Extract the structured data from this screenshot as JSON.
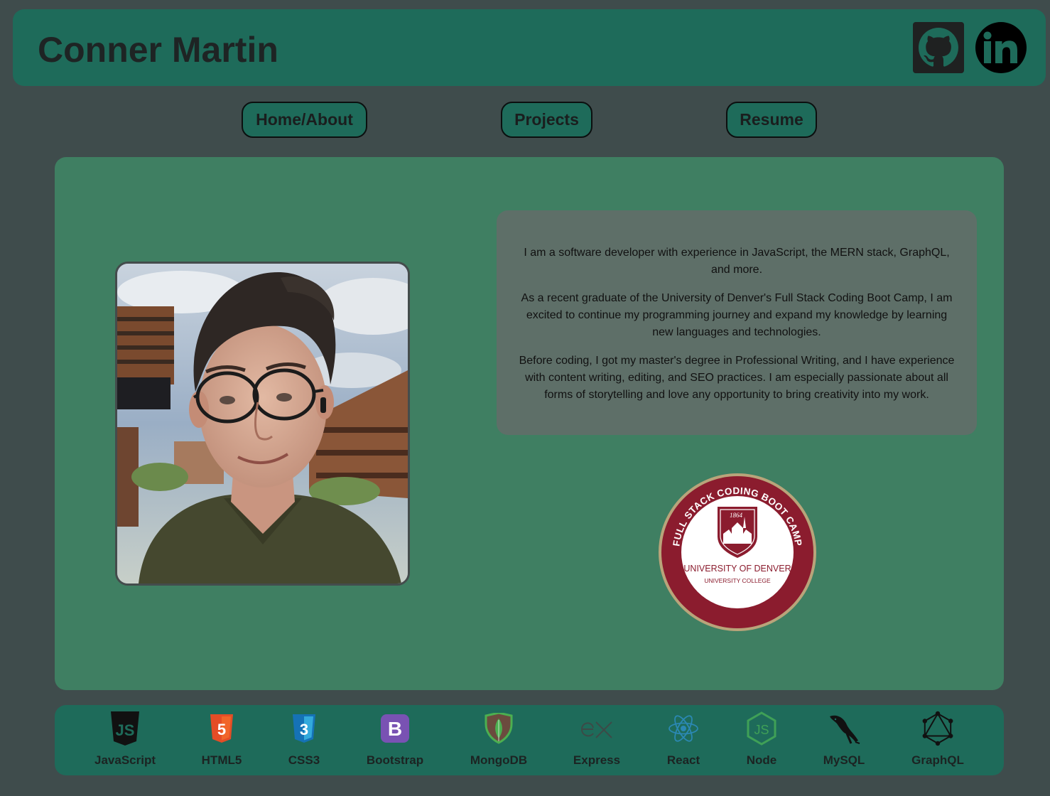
{
  "header": {
    "title": "Conner Martin",
    "github_icon": "github-icon",
    "linkedin_icon": "linkedin-icon"
  },
  "nav": {
    "home": "Home/About",
    "projects": "Projects",
    "resume": "Resume"
  },
  "about": {
    "paragraphs": [
      "I am a software developer with experience in JavaScript, the MERN stack, GraphQL, and more.",
      "As a recent graduate of the University of Denver's Full Stack Coding Boot Camp, I am excited to continue my programming journey and expand my knowledge by learning new languages and technologies.",
      "Before coding, I got my master's degree in Professional Writing, and I have experience with content writing, editing, and SEO practices. I am especially passionate about all forms of storytelling and love any opportunity to bring creativity into my work."
    ],
    "photo_icon": "profile-photo"
  },
  "badge": {
    "ring_text": "FULL STACK CODING BOOT CAMP",
    "year": "1864",
    "school": "UNIVERSITY OF DENVER",
    "college": "UNIVERSITY COLLEGE"
  },
  "skills": [
    {
      "label": "JavaScript",
      "icon": "javascript-icon"
    },
    {
      "label": "HTML5",
      "icon": "html5-icon"
    },
    {
      "label": "CSS3",
      "icon": "css3-icon"
    },
    {
      "label": "Bootstrap",
      "icon": "bootstrap-icon"
    },
    {
      "label": "MongoDB",
      "icon": "mongodb-icon"
    },
    {
      "label": "Express",
      "icon": "express-icon"
    },
    {
      "label": "React",
      "icon": "react-icon"
    },
    {
      "label": "Node",
      "icon": "node-icon"
    },
    {
      "label": "MySQL",
      "icon": "mysql-icon"
    },
    {
      "label": "GraphQL",
      "icon": "graphql-icon"
    }
  ],
  "colors": {
    "page_bg": "#3f4c4c",
    "header_bg": "#1e6b5a",
    "main_bg": "#3f7f62",
    "about_bg": "#5e6f68",
    "badge_red": "#8b1c2e",
    "badge_gold": "#b9a47a"
  }
}
